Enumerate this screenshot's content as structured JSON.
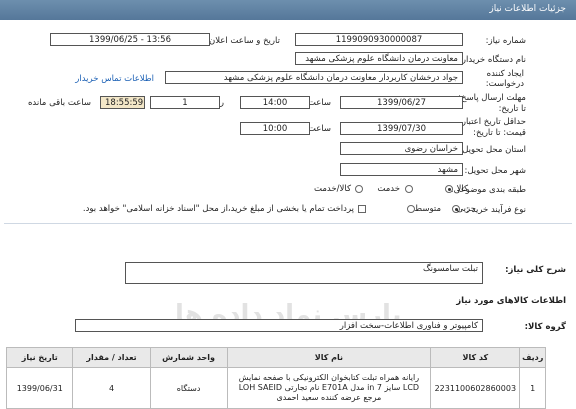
{
  "header": {
    "title": "جزئیات اطلاعات نیاز"
  },
  "form": {
    "need_number_label": "شماره نیاز:",
    "need_number": "1199090930000087",
    "announce_label": "تاریخ و ساعت اعلان عمومی:",
    "announce_value": "1399/06/25 - 13:56",
    "buyer_label": "نام دستگاه خریدار:",
    "buyer_value": "معاونت درمان دانشگاه علوم پزشکی مشهد",
    "creator_label_1": "ایجاد کننده",
    "creator_label_2": "درخواست:",
    "creator_value": "جواد درخشان کاربردار معاونت درمان دانشگاه علوم پزشکی مشهد",
    "contact_link": "اطلاعات تماس خریدار",
    "deadline_label_1": "مهلت ارسال پاسخ:",
    "deadline_label_2": "تا تاریخ:",
    "deadline_date": "1399/06/27",
    "time_label": "ساعت",
    "deadline_time": "14:00",
    "days_label": "روز و",
    "days_value": "1",
    "remaining_time": "18:55:59",
    "remaining_label": "ساعت باقی مانده",
    "validity_label_1": "حداقل تاریخ اعتبار",
    "validity_label_2": "قیمت: تا تاریخ:",
    "validity_date": "1399/07/30",
    "validity_time_label": "ساعت",
    "validity_time": "10:00",
    "province_label": "استان محل تحویل:",
    "province_value": "خراسان رضوی",
    "city_label": "شهر محل تحویل:",
    "city_value": "مشهد",
    "category_label": "طبقه بندی موضوعی:",
    "category_options": [
      "کالا",
      "خدمت",
      "کالا/خدمت"
    ],
    "process_label": "نوع فرآیند خرید :",
    "process_options": [
      "جزیی",
      "متوسط"
    ],
    "payment_note": "پرداخت تمام یا بخشی از مبلغ خرید،از محل \"اسناد خزانه اسلامی\" خواهد بود."
  },
  "summary": {
    "label": "شرح کلی نیاز:",
    "value": "تبلت سامسونگ"
  },
  "goods_section_title": "اطلاعات کالاهای مورد نیاز",
  "group": {
    "label": "گروه کالا:",
    "value": "کامپیوتر و فناوری اطلاعات-سخت افزار"
  },
  "watermark_text": "پارس نماد داده ها",
  "table": {
    "headers": {
      "row": "ردیف",
      "code": "کد کالا",
      "name": "نام کالا",
      "unit": "واحد شمارش",
      "qty": "تعداد / مقدار",
      "date": "تاریخ نیاز"
    },
    "rows": [
      {
        "row": "1",
        "code": "2231100602860003",
        "name": "رایانه همراه تبلت کتابخوان الکترونیکی با صفحه نمایش LCD سایز in 7 مدل E701A نام تجارتی LOH SAEID مرجع عرضه کننده سعید احمدی",
        "unit": "دستگاه",
        "qty": "4",
        "date": "1399/06/31"
      }
    ]
  }
}
